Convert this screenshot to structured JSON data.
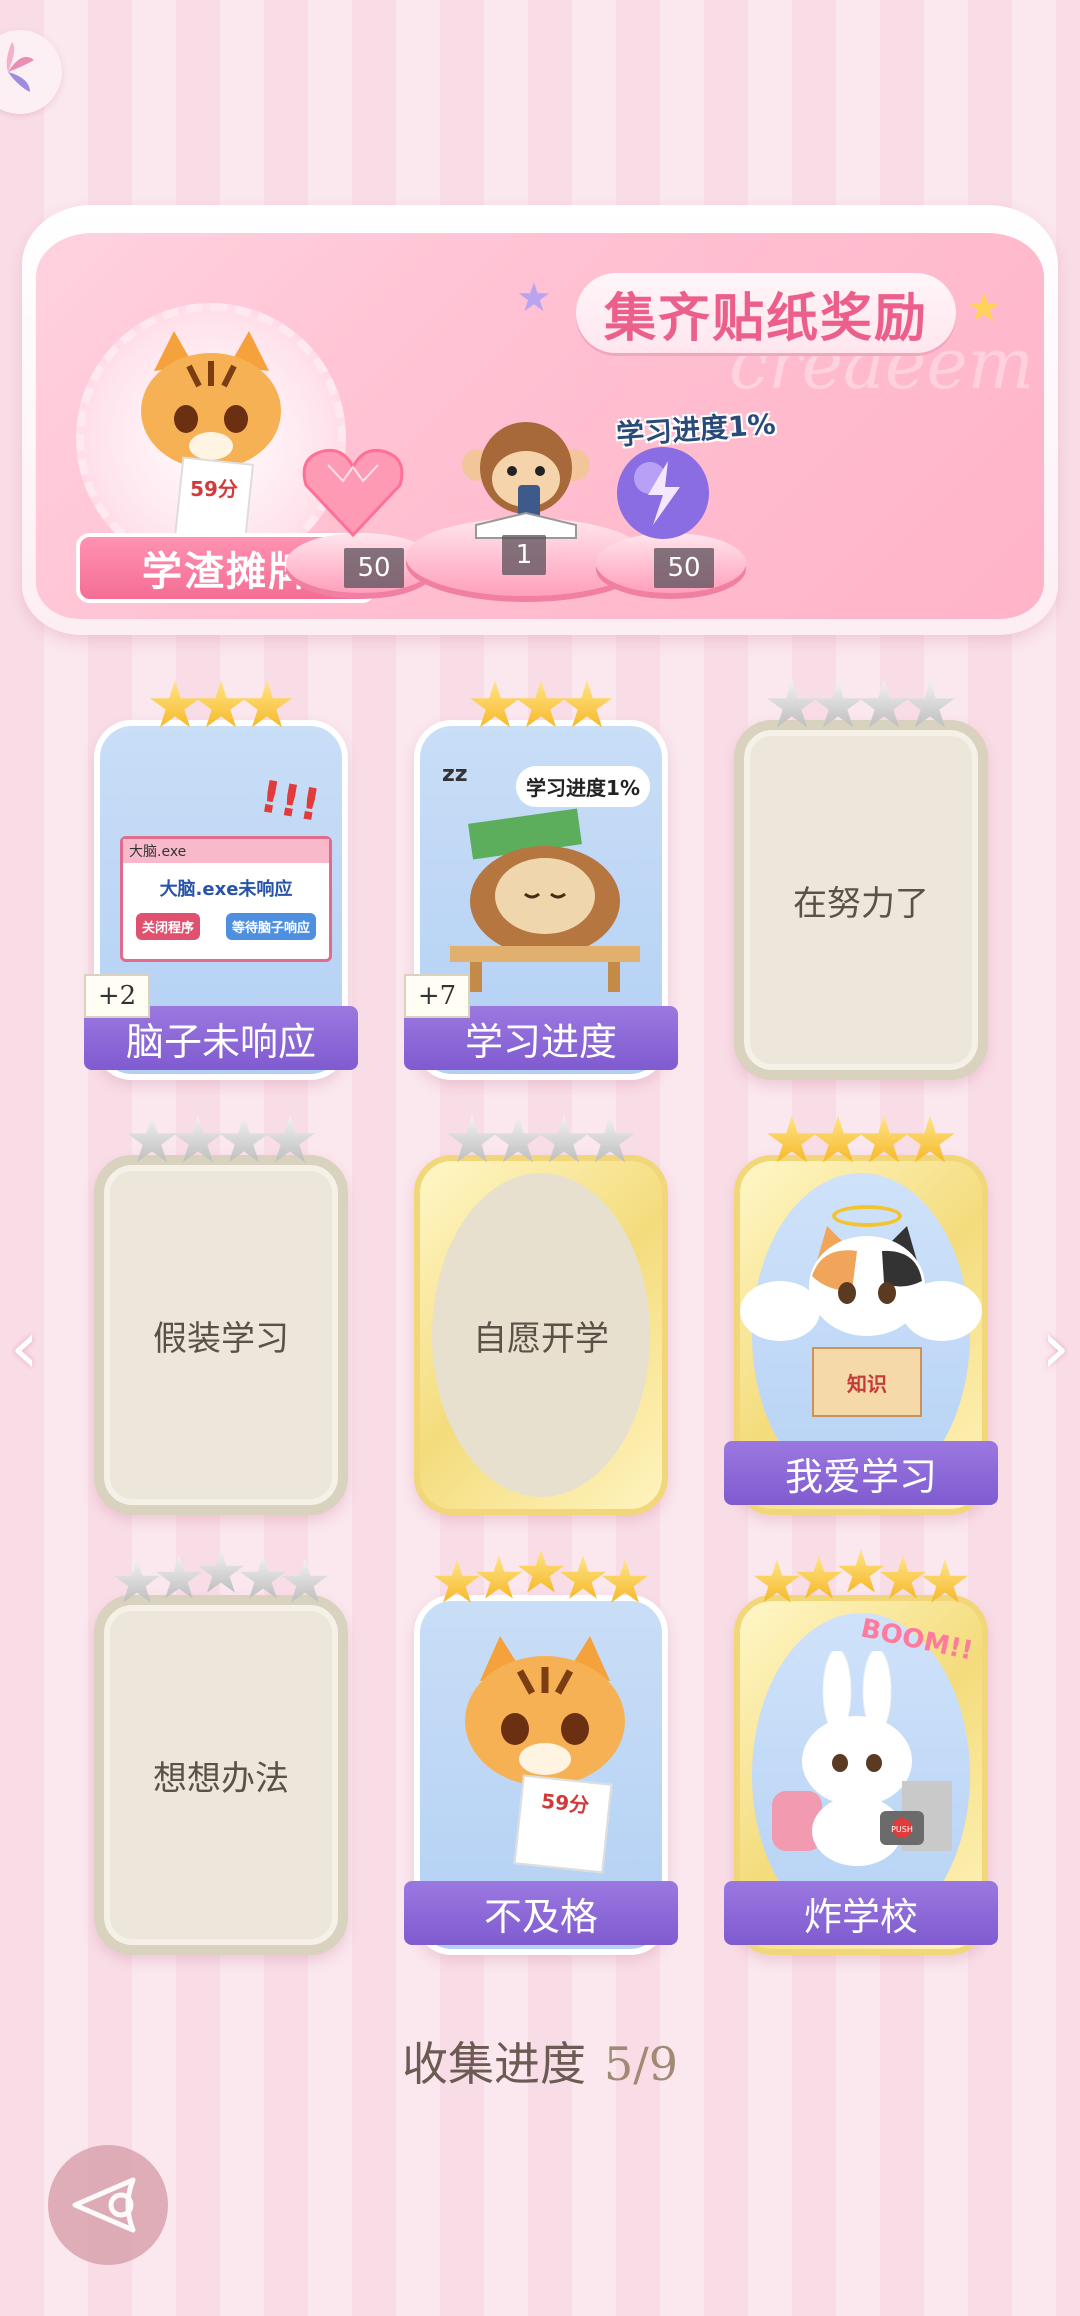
{
  "banner": {
    "title": "集齐贴纸奖励",
    "watermark": "creaeem",
    "badge_label": "学渣摊牌",
    "badge_paper": "59分",
    "center_caption": "学习进度1%",
    "rewards": [
      {
        "icon": "heart-gem-icon",
        "count": "50"
      },
      {
        "icon": "monkey-sticker-icon",
        "count": "1"
      },
      {
        "icon": "lightning-orb-icon",
        "count": "50"
      }
    ]
  },
  "cards": [
    {
      "name": "脑子未响应",
      "stars": 3,
      "filled": 3,
      "unlocked": true,
      "plus": "+2",
      "window_title": "大脑.exe",
      "window_msg": "大脑.exe未响应",
      "btn_close": "关闭程序",
      "btn_wait": "等待脑子响应",
      "exclaim": "!!!"
    },
    {
      "name": "学习进度",
      "stars": 3,
      "filled": 3,
      "unlocked": true,
      "plus": "+7",
      "bubble": "学习进度1%",
      "zz": "zz"
    },
    {
      "name": "在努力了",
      "stars": 4,
      "filled": 0,
      "unlocked": false
    },
    {
      "name": "假装学习",
      "stars": 4,
      "filled": 0,
      "unlocked": false
    },
    {
      "name": "自愿开学",
      "stars": 4,
      "filled": 0,
      "unlocked": false
    },
    {
      "name": "我爱学习",
      "stars": 4,
      "filled": 4,
      "unlocked": true,
      "book": "知识"
    },
    {
      "name": "想想办法",
      "stars": 5,
      "filled": 0,
      "unlocked": false
    },
    {
      "name": "不及格",
      "stars": 5,
      "filled": 5,
      "unlocked": true,
      "paper": "59分"
    },
    {
      "name": "炸学校",
      "stars": 5,
      "filled": 5,
      "unlocked": true,
      "boom": "BOOM!!",
      "push": "PUSH"
    }
  ],
  "collect": {
    "label": "收集进度",
    "value": "5/9"
  },
  "nav": {
    "prev": "‹",
    "next": "›"
  },
  "colors": {
    "accent_pink": "#ec5f8a",
    "name_banner": "#8a67d6",
    "gold_star": "#f5b51f",
    "grey_star": "#c4c4c4"
  }
}
